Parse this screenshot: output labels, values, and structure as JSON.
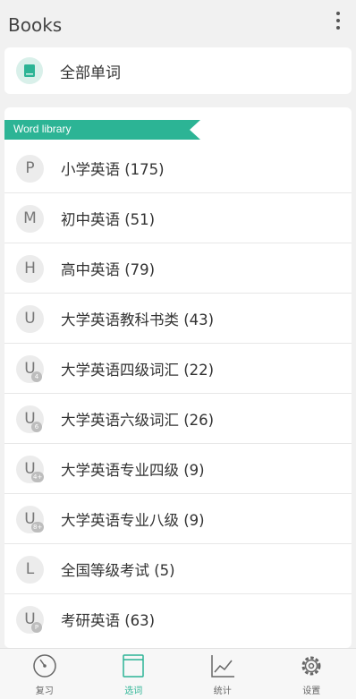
{
  "header": {
    "title": "Books"
  },
  "all_words": {
    "label": "全部单词"
  },
  "library": {
    "title": "Word library",
    "items": [
      {
        "letter": "P",
        "level": "",
        "label": "小学英语 (175)"
      },
      {
        "letter": "M",
        "level": "",
        "label": "初中英语 (51)"
      },
      {
        "letter": "H",
        "level": "",
        "label": "高中英语 (79)"
      },
      {
        "letter": "U",
        "level": "",
        "label": "大学英语教科书类 (43)"
      },
      {
        "letter": "U",
        "level": "4",
        "label": "大学英语四级词汇 (22)"
      },
      {
        "letter": "U",
        "level": "6",
        "label": "大学英语六级词汇 (26)"
      },
      {
        "letter": "U",
        "level": "4+",
        "label": "大学英语专业四级 (9)"
      },
      {
        "letter": "U",
        "level": "8+",
        "label": "大学英语专业八级 (9)"
      },
      {
        "letter": "L",
        "level": "",
        "label": "全国等级考试 (5)"
      },
      {
        "letter": "U",
        "level": "P",
        "label": "考研英语 (63)"
      }
    ]
  },
  "tabs": [
    {
      "label": "复习",
      "icon": "review-gauge-icon"
    },
    {
      "label": "选词",
      "icon": "select-words-book-icon",
      "active": true
    },
    {
      "label": "统计",
      "icon": "statistics-chart-icon"
    },
    {
      "label": "设置",
      "icon": "settings-gear-icon"
    }
  ],
  "colors": {
    "accent": "#2cb495",
    "background": "#f1f1f1"
  }
}
